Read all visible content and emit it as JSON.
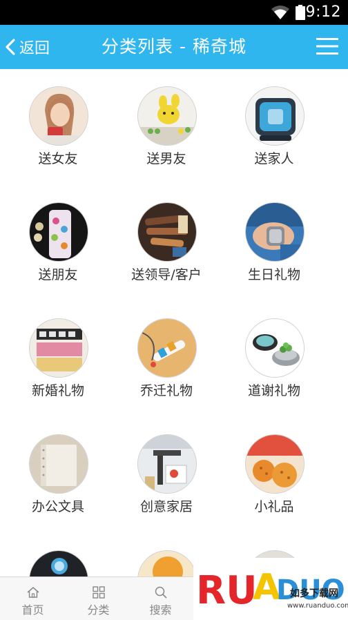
{
  "status_bar": {
    "time": "9:12",
    "wifi_icon": "wifi-icon",
    "battery_icon": "battery-icon"
  },
  "header": {
    "back_label": "返回",
    "title": "分类列表 - 稀奇城",
    "menu_icon": "hamburger-menu-icon",
    "background": "#2fb6ee"
  },
  "categories": [
    {
      "label": "送女友"
    },
    {
      "label": "送男友"
    },
    {
      "label": "送家人"
    },
    {
      "label": "送朋友"
    },
    {
      "label": "送领导/客户"
    },
    {
      "label": "生日礼物"
    },
    {
      "label": "新婚礼物"
    },
    {
      "label": "乔迁礼物"
    },
    {
      "label": "道谢礼物"
    },
    {
      "label": "办公文具"
    },
    {
      "label": "创意家居"
    },
    {
      "label": "小礼品"
    }
  ],
  "tabbar": {
    "tabs": [
      {
        "label": "首页",
        "icon": "home-icon"
      },
      {
        "label": "分类",
        "icon": "grid-icon"
      },
      {
        "label": "搜索",
        "icon": "search-icon"
      }
    ]
  },
  "watermark": {
    "brand": "RUANDUO",
    "tagline": "如多下载网",
    "url": "www.ruanduo.com"
  }
}
